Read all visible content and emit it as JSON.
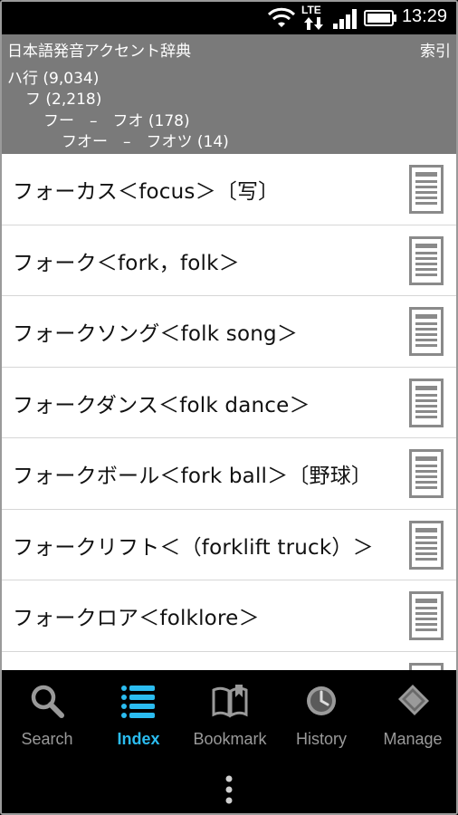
{
  "status": {
    "network": "LTE",
    "time": "13:29"
  },
  "header": {
    "title": "日本語発音アクセント辞典",
    "action": "索引",
    "breadcrumbs": [
      "ハ行 (9,034)",
      "フ (2,218)",
      "フー　–　フオ (178)",
      "フオー　–　フオツ (14)"
    ]
  },
  "entries": [
    "フォーカス＜focus＞〔写〕",
    "フォーク＜fork，folk＞",
    "フォークソング＜folk song＞",
    "フォークダンス＜folk dance＞",
    "フォークボール＜fork ball＞〔野球〕",
    "フォークリフト＜（forklift truck）＞",
    "フォークロア＜folklore＞"
  ],
  "nav": {
    "items": [
      {
        "label": "Search",
        "icon": "search-icon"
      },
      {
        "label": "Index",
        "icon": "list-icon",
        "active": true
      },
      {
        "label": "Bookmark",
        "icon": "bookmark-icon"
      },
      {
        "label": "History",
        "icon": "history-icon"
      },
      {
        "label": "Manage",
        "icon": "manage-icon"
      }
    ]
  },
  "colors": {
    "header_bg": "#7a7a7a",
    "active_tab": "#2bbcf0",
    "inactive_tab": "#9a9a9a"
  }
}
